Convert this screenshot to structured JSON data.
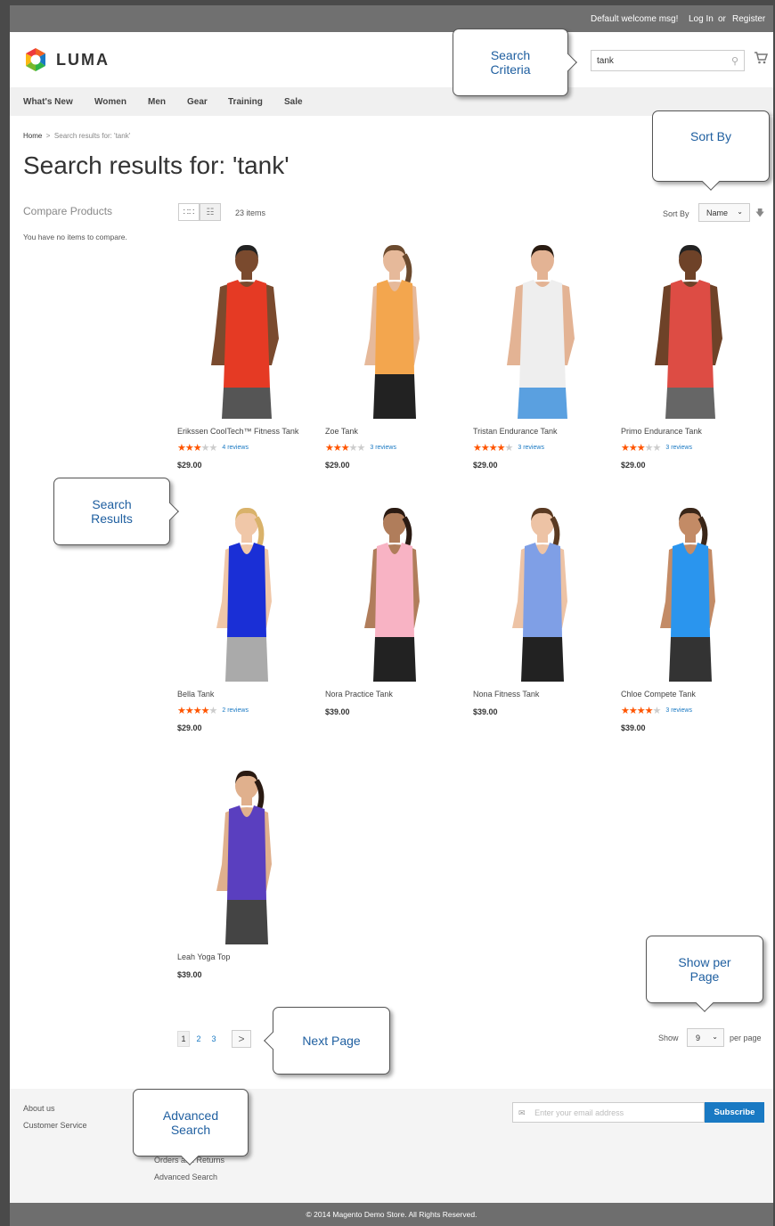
{
  "topbar": {
    "welcome": "Default welcome msg!",
    "login": "Log In",
    "or": "or",
    "register": "Register"
  },
  "header": {
    "logo_text": "LUMA",
    "search_value": "tank"
  },
  "nav": [
    "What's New",
    "Women",
    "Men",
    "Gear",
    "Training",
    "Sale"
  ],
  "breadcrumb": {
    "home": "Home",
    "sep": ">",
    "current": "Search results for: 'tank'"
  },
  "page_title": "Search results for: 'tank'",
  "sidebar": {
    "compare_title": "Compare Products",
    "compare_text": "You have no items to compare."
  },
  "toolbar": {
    "count": "23 items",
    "sort_label": "Sort By",
    "sort_value": "Name"
  },
  "products": [
    {
      "name": "Erikssen CoolTech™ Fitness Tank",
      "stars": 3,
      "reviews": "4 reviews",
      "price": "$29.00",
      "shirt": "#e53a24",
      "skin": "#7a4a2e",
      "hair": "#222",
      "shorts": "#555"
    },
    {
      "name": "Zoe Tank",
      "stars": 3,
      "reviews": "3 reviews",
      "price": "$29.00",
      "shirt": "#f3a64e",
      "skin": "#e6b99a",
      "hair": "#6b4a2e",
      "shorts": "#222"
    },
    {
      "name": "Tristan Endurance Tank",
      "stars": 4,
      "reviews": "3 reviews",
      "price": "$29.00",
      "shirt": "#eeeeee",
      "skin": "#e3b394",
      "hair": "#2a1c12",
      "shorts": "#5aa0e0"
    },
    {
      "name": "Primo Endurance Tank",
      "stars": 3,
      "reviews": "3 reviews",
      "price": "$29.00",
      "shirt": "#dd4c44",
      "skin": "#6e4228",
      "hair": "#222",
      "shorts": "#666"
    },
    {
      "name": "Bella Tank",
      "stars": 4,
      "reviews": "2 reviews",
      "price": "$29.00",
      "shirt": "#1a2fd6",
      "skin": "#f0c7a8",
      "hair": "#d9b26a",
      "shorts": "#aaa"
    },
    {
      "name": "Nora Practice Tank",
      "stars": 0,
      "reviews": "",
      "price": "$39.00",
      "shirt": "#f8b3c4",
      "skin": "#b07d5b",
      "hair": "#2a1a12",
      "shorts": "#222"
    },
    {
      "name": "Nona Fitness Tank",
      "stars": 0,
      "reviews": "",
      "price": "$39.00",
      "shirt": "#7f9fe6",
      "skin": "#edc3a5",
      "hair": "#5a3a22",
      "shorts": "#222"
    },
    {
      "name": "Chloe Compete Tank",
      "stars": 4,
      "reviews": "3 reviews",
      "price": "$39.00",
      "shirt": "#2a95ee",
      "skin": "#c38b66",
      "hair": "#3a2618",
      "shorts": "#333"
    },
    {
      "name": "Leah Yoga Top",
      "stars": 0,
      "reviews": "",
      "price": "$39.00",
      "shirt": "#5a3fbf",
      "skin": "#e0b08d",
      "hair": "#2a1a12",
      "shorts": "#444"
    }
  ],
  "pagination": {
    "pages": [
      "1",
      "2",
      "3"
    ],
    "next": ">",
    "show_label": "Show",
    "show_value": "9",
    "per_page": "per page"
  },
  "footer": {
    "links": [
      "About us",
      "Customer Service",
      "Orders and Returns",
      "Advanced Search"
    ],
    "email_placeholder": "Enter your email address",
    "subscribe": "Subscribe",
    "copyright": "© 2014 Magento Demo Store. All Rights Reserved."
  },
  "callouts": {
    "search_criteria": "Search Criteria",
    "sort_by": "Sort By",
    "search_results": "Search Results",
    "next_page": "Next Page",
    "show_per_page": "Show per Page",
    "advanced_search": "Advanced Search"
  },
  "colors": {
    "accent": "#1979c3",
    "star": "#ff5501",
    "callout_text": "#1f5fa0"
  }
}
